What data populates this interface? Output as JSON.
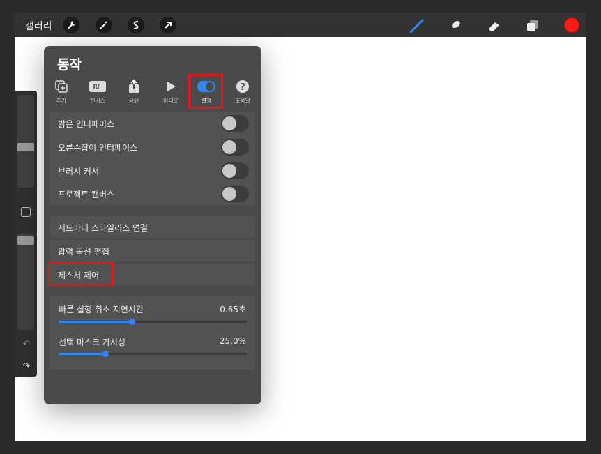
{
  "topbar": {
    "gallery_label": "갤러리",
    "tools_left": [
      "wrench-icon",
      "magic-wand-icon",
      "selection-icon",
      "transform-arrow-icon"
    ],
    "tools_right": [
      "brush-icon",
      "smudge-icon",
      "eraser-icon",
      "layers-icon"
    ],
    "current_color": "#ff1a1a",
    "brush_color": "#2f86f6"
  },
  "popover": {
    "title": "동작",
    "tabs": [
      {
        "label": "추가",
        "icon": "add-icon"
      },
      {
        "label": "캔버스",
        "icon": "canvas-icon"
      },
      {
        "label": "공유",
        "icon": "share-icon"
      },
      {
        "label": "비디오",
        "icon": "video-icon"
      },
      {
        "label": "설정",
        "icon": "settings-toggle-icon"
      },
      {
        "label": "도움말",
        "icon": "help-icon"
      }
    ],
    "toggles": [
      {
        "label": "밝은 인터페이스",
        "on": false
      },
      {
        "label": "오른손잡이 인터페이스",
        "on": false
      },
      {
        "label": "브러시 커서",
        "on": false
      },
      {
        "label": "프로젝트 캔버스",
        "on": false
      }
    ],
    "links": [
      {
        "label": "서드파티 스타일러스 연결"
      },
      {
        "label": "압력 곡선 편집"
      },
      {
        "label": "제스처 제어"
      }
    ],
    "sliders": [
      {
        "label": "빠른 실행 취소 지연시간",
        "value_text": "0.65초",
        "fraction": 0.39
      },
      {
        "label": "선택 마스크 가시성",
        "value_text": "25.0%",
        "fraction": 0.25
      }
    ]
  },
  "colors": {
    "accent": "#2f86f6",
    "highlight": "#e8151b",
    "panel": "#4a4a4a"
  }
}
